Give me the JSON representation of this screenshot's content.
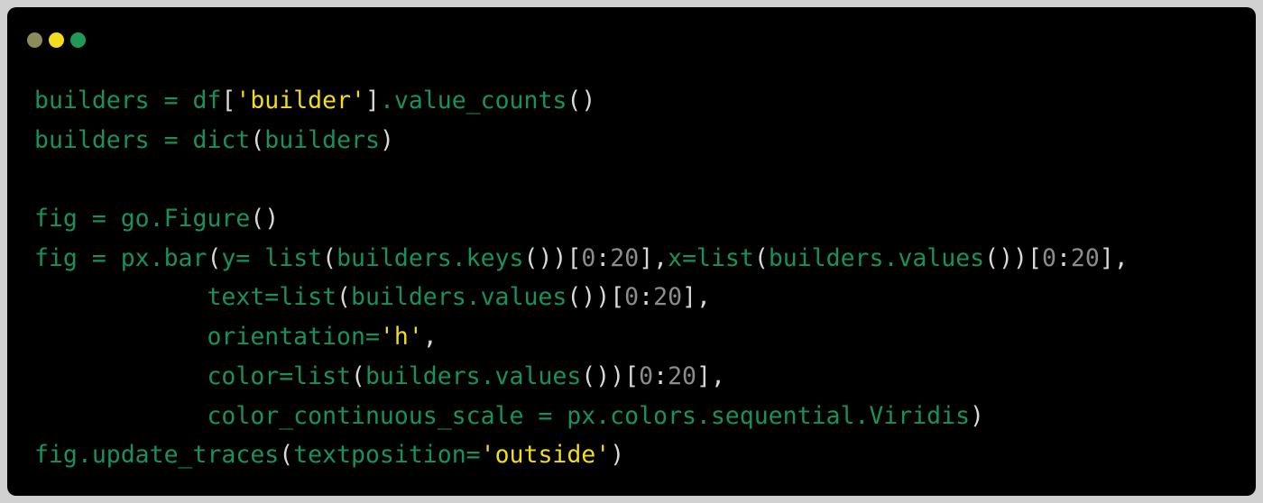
{
  "window": {
    "background": "#000000",
    "traffic_lights": [
      {
        "name": "close",
        "color": "#8c8c5a"
      },
      {
        "name": "minimize",
        "color": "#f3dc1e"
      },
      {
        "name": "zoom",
        "color": "#1f9a56"
      }
    ]
  },
  "colors": {
    "default": "#18915a",
    "string": "#f0dd1c",
    "number": "#8c8c8c",
    "punct": "#d8d8d8"
  },
  "code_lines": [
    [
      [
        "builders = df",
        "default"
      ],
      [
        "[",
        "punct"
      ],
      [
        "'builder'",
        "string"
      ],
      [
        "]",
        "punct"
      ],
      [
        ".value_counts",
        "default"
      ],
      [
        "()",
        "punct"
      ]
    ],
    [
      [
        "builders = dict",
        "default"
      ],
      [
        "(",
        "punct"
      ],
      [
        "builders",
        "default"
      ],
      [
        ")",
        "punct"
      ]
    ],
    [],
    [
      [
        "fig = go.Figure",
        "default"
      ],
      [
        "()",
        "punct"
      ]
    ],
    [
      [
        "fig = px.bar",
        "default"
      ],
      [
        "(",
        "punct"
      ],
      [
        "y= list",
        "default"
      ],
      [
        "(",
        "punct"
      ],
      [
        "builders.keys",
        "default"
      ],
      [
        "())[",
        "punct"
      ],
      [
        "0",
        "number"
      ],
      [
        ":",
        "punct"
      ],
      [
        "20",
        "number"
      ],
      [
        "],",
        "punct"
      ],
      [
        "x=list",
        "default"
      ],
      [
        "(",
        "punct"
      ],
      [
        "builders.values",
        "default"
      ],
      [
        "())[",
        "punct"
      ],
      [
        "0",
        "number"
      ],
      [
        ":",
        "punct"
      ],
      [
        "20",
        "number"
      ],
      [
        "],",
        "punct"
      ]
    ],
    [
      [
        "            text=list",
        "default"
      ],
      [
        "(",
        "punct"
      ],
      [
        "builders.values",
        "default"
      ],
      [
        "())[",
        "punct"
      ],
      [
        "0",
        "number"
      ],
      [
        ":",
        "punct"
      ],
      [
        "20",
        "number"
      ],
      [
        "],",
        "punct"
      ]
    ],
    [
      [
        "            orientation=",
        "default"
      ],
      [
        "'h'",
        "string"
      ],
      [
        ",",
        "punct"
      ]
    ],
    [
      [
        "            color=list",
        "default"
      ],
      [
        "(",
        "punct"
      ],
      [
        "builders.values",
        "default"
      ],
      [
        "())[",
        "punct"
      ],
      [
        "0",
        "number"
      ],
      [
        ":",
        "punct"
      ],
      [
        "20",
        "number"
      ],
      [
        "],",
        "punct"
      ]
    ],
    [
      [
        "            color_continuous_scale = px.colors.sequential.Viridis",
        "default"
      ],
      [
        ")",
        "punct"
      ]
    ],
    [
      [
        "fig.update_traces",
        "default"
      ],
      [
        "(",
        "punct"
      ],
      [
        "textposition=",
        "default"
      ],
      [
        "'outside'",
        "string"
      ],
      [
        ")",
        "punct"
      ]
    ]
  ]
}
